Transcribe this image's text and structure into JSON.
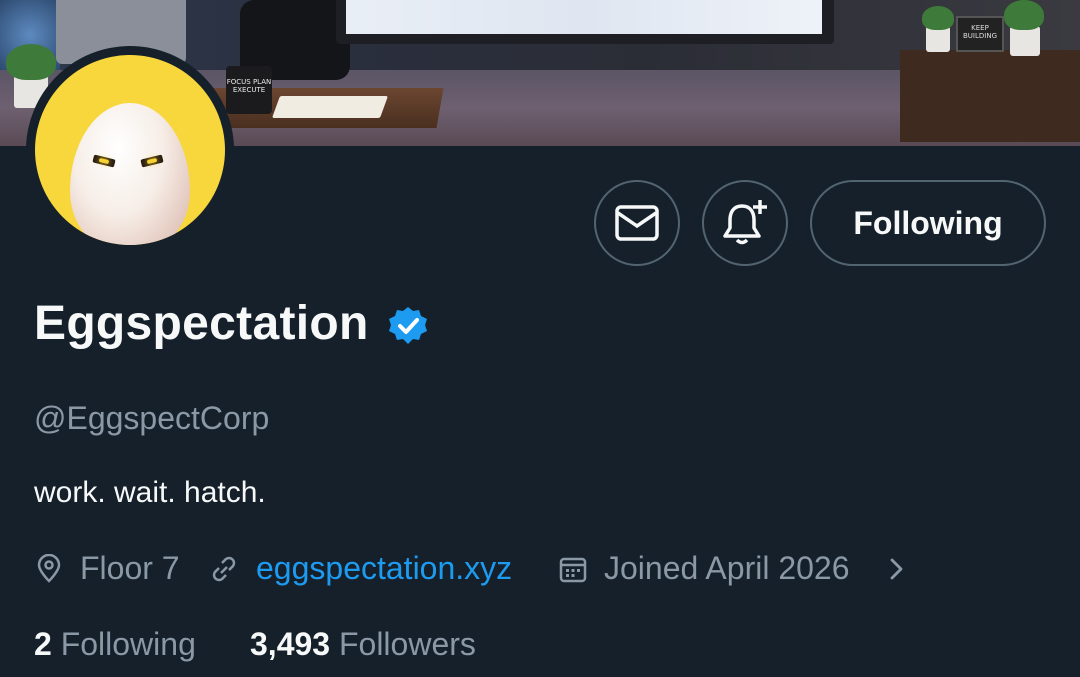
{
  "banner": {
    "mug_text": "FOCUS PLAN EXECUTE",
    "sign_text": "KEEP BUILDING"
  },
  "profile": {
    "display_name": "Eggspectation",
    "handle": "@EggspectCorp",
    "bio": "work. wait. hatch.",
    "location": "Floor 7",
    "website": "eggspectation.xyz",
    "joined": "Joined April 2026",
    "verified": true
  },
  "actions": {
    "message_icon": "envelope-icon",
    "notify_icon": "bell-plus-icon",
    "follow_label": "Following"
  },
  "stats": {
    "following_count": "2",
    "following_label": "Following",
    "followers_count": "3,493",
    "followers_label": "Followers"
  },
  "colors": {
    "background": "#15202b",
    "accent": "#1d9bf0",
    "muted_text": "#8b98a5",
    "avatar_bg": "#f8d73c"
  }
}
